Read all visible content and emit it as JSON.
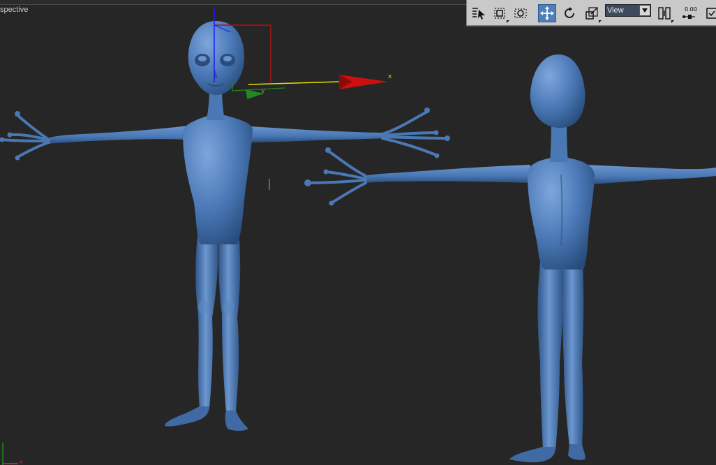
{
  "viewport": {
    "label": "spective",
    "background": "#262626"
  },
  "toolbar": {
    "tools": [
      {
        "name": "select-object-icon",
        "active": false
      },
      {
        "name": "region-select-icon",
        "active": false
      },
      {
        "name": "window-crossing-icon",
        "active": false
      },
      {
        "name": "move-icon",
        "active": true
      },
      {
        "name": "rotate-icon",
        "active": false
      },
      {
        "name": "scale-icon",
        "active": false
      },
      {
        "name": "pivot-icon",
        "active": false
      },
      {
        "name": "snap-toggle-icon",
        "active": false
      },
      {
        "name": "keyboard-shortcut-icon",
        "active": false
      }
    ],
    "reference_coord_value": "View",
    "snap_value": "0.00"
  },
  "gizmo": {
    "x_label": "x",
    "y_label": "y",
    "colors": {
      "x": "#cc1010",
      "y": "#1f8a1f",
      "z": "#1a1aff",
      "selection_box": "#b01010",
      "x_axis_line": "#e8e000"
    }
  },
  "corner_axes": {
    "x_label": "x"
  },
  "model": {
    "color": "#4a78b5",
    "color_light": "#6b96cf",
    "color_dark": "#2c4f80"
  },
  "colors": {
    "toolbar_bg": "#c9c9c9",
    "active_tool": "#4f7fb8"
  }
}
